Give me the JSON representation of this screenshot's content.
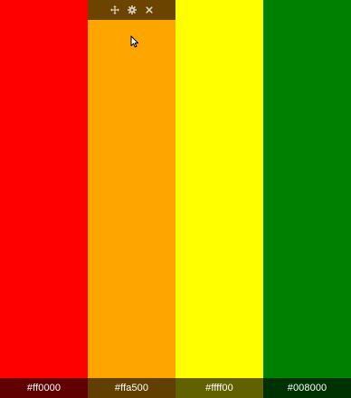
{
  "swatches": [
    {
      "hex": "#ff0000",
      "color": "#ff0000"
    },
    {
      "hex": "#ffa500",
      "color": "#ffa500"
    },
    {
      "hex": "#ffff00",
      "color": "#ffff00"
    },
    {
      "hex": "#008000",
      "color": "#008000"
    }
  ],
  "toolbar": {
    "active_swatch_index": 1,
    "icons": [
      "move-icon",
      "gear-icon",
      "close-icon"
    ],
    "icon_color": "#d8d0c0"
  }
}
